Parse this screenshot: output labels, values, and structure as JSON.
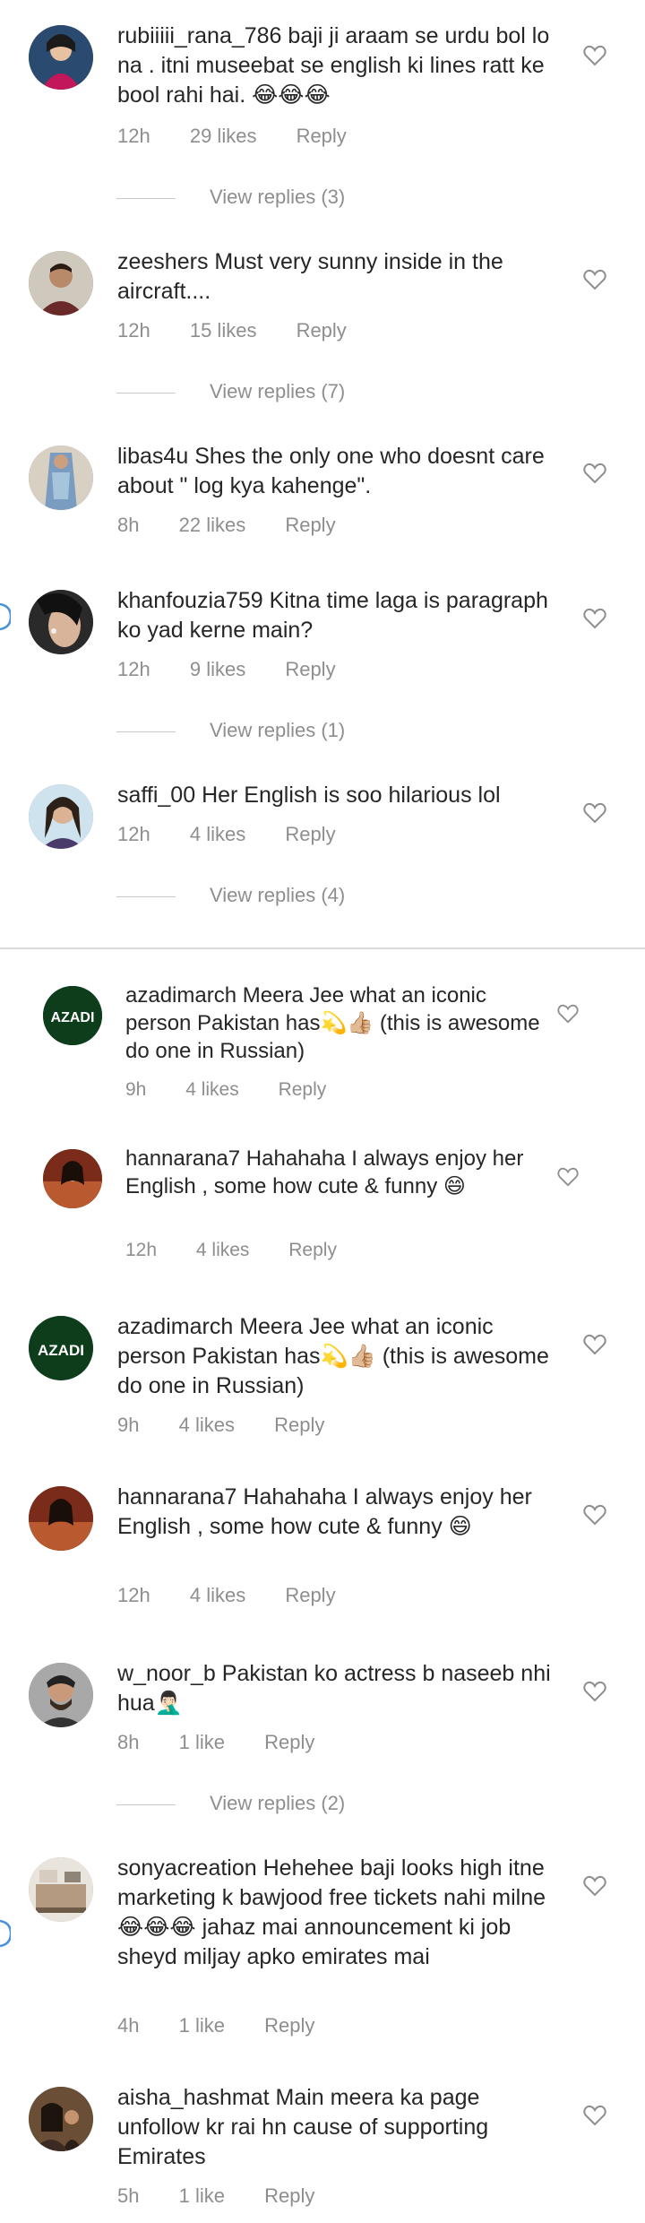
{
  "comments": [
    {
      "user": "rubiiiii_rana_786",
      "text": "baji ji araam se urdu bol lo na . itni museebat se english ki lines ratt ke bool rahi hai. 😂😂😂",
      "time": "12h",
      "likes": "29 likes",
      "reply": "Reply",
      "view_replies": "View replies (3)"
    },
    {
      "user": "zeeshers",
      "text": "Must very sunny inside in the aircraft....",
      "time": "12h",
      "likes": "15 likes",
      "reply": "Reply",
      "view_replies": "View replies (7)"
    },
    {
      "user": "libas4u",
      "text": "Shes the only one who doesnt care about \" log kya kahenge\".",
      "time": "8h",
      "likes": "22 likes",
      "reply": "Reply"
    },
    {
      "user": "khanfouzia759",
      "text": "Kitna time laga is paragraph ko yad kerne main?",
      "time": "12h",
      "likes": "9 likes",
      "reply": "Reply",
      "view_replies": "View replies (1)"
    },
    {
      "user": "saffi_00",
      "text": "Her English is soo hilarious lol",
      "time": "12h",
      "likes": "4 likes",
      "reply": "Reply",
      "view_replies": "View replies (4)"
    },
    {
      "user": "azadimarch",
      "text": "Meera Jee what an iconic person Pakistan has💫👍🏼 (this is awesome do one in Russian)",
      "time": "9h",
      "likes": "4 likes",
      "reply": "Reply"
    },
    {
      "user": "hannarana7",
      "text": "Hahahaha I always enjoy her English , some how cute & funny 😄",
      "time": "12h",
      "likes": "4 likes",
      "reply": "Reply"
    },
    {
      "user": "azadimarch",
      "text": "Meera Jee what an iconic person Pakistan has💫👍🏼 (this is awesome do one in Russian)",
      "time": "9h",
      "likes": "4 likes",
      "reply": "Reply"
    },
    {
      "user": "hannarana7",
      "text": "Hahahaha I always enjoy her English , some how cute & funny 😄",
      "time": "12h",
      "likes": "4 likes",
      "reply": "Reply"
    },
    {
      "user": "w_noor_b",
      "text": "Pakistan ko actress b naseeb nhi hua🤦🏻‍♂️",
      "time": "8h",
      "likes": "1 like",
      "reply": "Reply",
      "view_replies": "View replies (2)"
    },
    {
      "user": "sonyacreation",
      "text": "Hehehee baji looks high itne marketing k bawjood free tickets nahi milne 😂😂😂 jahaz mai announcement ki job sheyd miljay apko emirates mai",
      "time": "4h",
      "likes": "1 like",
      "reply": "Reply"
    },
    {
      "user": "aisha_hashmat",
      "text": "Main meera ka page unfollow kr rai hn cause of supporting Emirates",
      "time": "5h",
      "likes": "1 like",
      "reply": "Reply"
    }
  ],
  "avatar_badge_text": "AZADI",
  "icons": {
    "like": "heart-outline-icon",
    "side": "headphone-icon"
  },
  "colors": {
    "text": "#262626",
    "meta": "#8e8e8e",
    "divider": "#dbdbdb"
  }
}
